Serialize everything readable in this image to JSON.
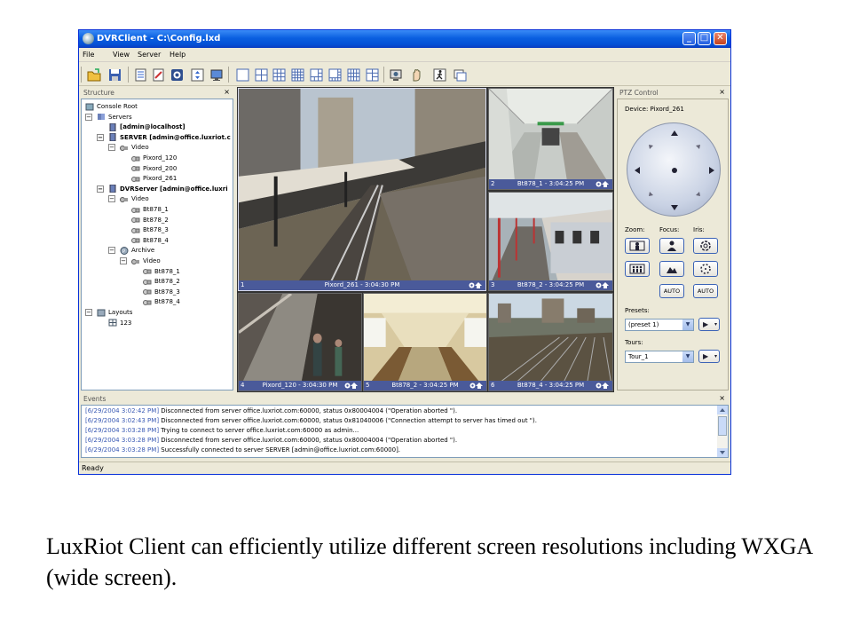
{
  "window": {
    "title": "DVRClient - C:\\Config.lxd"
  },
  "window_buttons": {
    "min": "_",
    "max": "□",
    "close": "✕"
  },
  "menu": [
    "File",
    "View",
    "Server",
    "Help"
  ],
  "toolbar_icons": [
    "open-icon",
    "save-icon",
    "properties-icon",
    "edit-icon",
    "record-icon",
    "fullscreen-icon",
    "monitor-icon",
    "layout-1x1-icon",
    "layout-2x2-icon",
    "layout-3x3-icon",
    "layout-4x4-icon",
    "layout-1plus5-icon",
    "layout-1plus7-icon",
    "layout-4x3-icon",
    "layout-custom-icon",
    "snapshot-icon",
    "hand-icon",
    "motion-icon",
    "window-icon"
  ],
  "structure": {
    "title": "Structure",
    "close": "×",
    "tree": [
      {
        "label": "Console Root",
        "level": 0,
        "icon": "root-icon",
        "bold": false,
        "expander": ""
      },
      {
        "label": "Servers",
        "level": 1,
        "icon": "servers-icon",
        "bold": false,
        "expander": "−"
      },
      {
        "label": "[admin@localhost]",
        "level": 2,
        "icon": "server-icon",
        "bold": true,
        "expander": ""
      },
      {
        "label": "SERVER [admin@office.luxriot.c",
        "level": 2,
        "icon": "server-icon",
        "bold": true,
        "expander": "−"
      },
      {
        "label": "Video",
        "level": 3,
        "icon": "video-icon",
        "bold": false,
        "expander": "−"
      },
      {
        "label": "Pixord_120",
        "level": 4,
        "icon": "camera-icon",
        "bold": false,
        "expander": ""
      },
      {
        "label": "Pixord_200",
        "level": 4,
        "icon": "camera-icon",
        "bold": false,
        "expander": ""
      },
      {
        "label": "Pixord_261",
        "level": 4,
        "icon": "camera-icon",
        "bold": false,
        "expander": ""
      },
      {
        "label": "DVRServer [admin@office.luxri",
        "level": 2,
        "icon": "server-icon",
        "bold": true,
        "expander": "−"
      },
      {
        "label": "Video",
        "level": 3,
        "icon": "video-icon",
        "bold": false,
        "expander": "−"
      },
      {
        "label": "Bt878_1",
        "level": 4,
        "icon": "camera-icon",
        "bold": false,
        "expander": ""
      },
      {
        "label": "Bt878_2",
        "level": 4,
        "icon": "camera-icon",
        "bold": false,
        "expander": ""
      },
      {
        "label": "Bt878_3",
        "level": 4,
        "icon": "camera-icon",
        "bold": false,
        "expander": ""
      },
      {
        "label": "Bt878_4",
        "level": 4,
        "icon": "camera-icon",
        "bold": false,
        "expander": ""
      },
      {
        "label": "Archive",
        "level": 3,
        "icon": "archive-icon",
        "bold": false,
        "expander": "−"
      },
      {
        "label": "Video",
        "level": 4,
        "icon": "video-icon",
        "bold": false,
        "expander": "−"
      },
      {
        "label": "Bt878_1",
        "level": 5,
        "icon": "camera-icon",
        "bold": false,
        "expander": ""
      },
      {
        "label": "Bt878_2",
        "level": 5,
        "icon": "camera-icon",
        "bold": false,
        "expander": ""
      },
      {
        "label": "Bt878_3",
        "level": 5,
        "icon": "camera-icon",
        "bold": false,
        "expander": ""
      },
      {
        "label": "Bt878_4",
        "level": 5,
        "icon": "camera-icon",
        "bold": false,
        "expander": ""
      },
      {
        "label": "Layouts",
        "level": 1,
        "icon": "layouts-icon",
        "bold": false,
        "expander": "−"
      },
      {
        "label": "123",
        "level": 2,
        "icon": "layout-icon",
        "bold": false,
        "expander": ""
      }
    ]
  },
  "cameras": [
    {
      "num": "1",
      "label": "Pixord_261 - 3:04:30 PM",
      "scene": "train-station"
    },
    {
      "num": "2",
      "label": "Bt878_1 - 3:04:25 PM",
      "scene": "subway-platform"
    },
    {
      "num": "3",
      "label": "Bt878_2 - 3:04:25 PM",
      "scene": "train-platform"
    },
    {
      "num": "4",
      "label": "Pixord_120 - 3:04:30 PM",
      "scene": "escalator"
    },
    {
      "num": "5",
      "label": "Bt878_2 - 3:04:25 PM",
      "scene": "train-interior"
    },
    {
      "num": "6",
      "label": "Bt878_4 - 3:04:25 PM",
      "scene": "rail-yard"
    }
  ],
  "ptz": {
    "title": "PTZ Control",
    "close": "×",
    "device_label": "Device: Pixord_261",
    "zoom_label": "Zoom:",
    "focus_label": "Focus:",
    "iris_label": "Iris:",
    "auto_label": "AUTO",
    "presets_label": "Presets:",
    "presets_value": "(preset 1)",
    "tours_label": "Tours:",
    "tours_value": "Tour_1"
  },
  "events": {
    "title": "Events",
    "close": "×",
    "lines": [
      {
        "ts": "[6/29/2004 3:02:42 PM]",
        "msg": "Disconnected from server office.luxriot.com:60000, status 0x80004004 (\"Operation aborted \")."
      },
      {
        "ts": "[6/29/2004 3:02:43 PM]",
        "msg": "Disconnected from server office.luxriot.com:60000, status 0x81040006 (\"Connection attempt to server has timed out \")."
      },
      {
        "ts": "[6/29/2004 3:03:28 PM]",
        "msg": "Trying to connect to server office.luxriot.com:60000 as admin..."
      },
      {
        "ts": "[6/29/2004 3:03:28 PM]",
        "msg": "Disconnected from server office.luxriot.com:60000, status 0x80004004 (\"Operation aborted \")."
      },
      {
        "ts": "[6/29/2004 3:03:28 PM]",
        "msg": "Successfully connected to server SERVER [admin@office.luxriot.com:60000]."
      }
    ]
  },
  "status": "Ready",
  "caption": "LuxRiot Client can efficiently utilize different screen resolutions including WXGA (wide screen).",
  "colors": {
    "titlebar": "#0a5fe0",
    "caption_bar": "#4a5a9a",
    "timestamp": "#3a5ab4"
  }
}
